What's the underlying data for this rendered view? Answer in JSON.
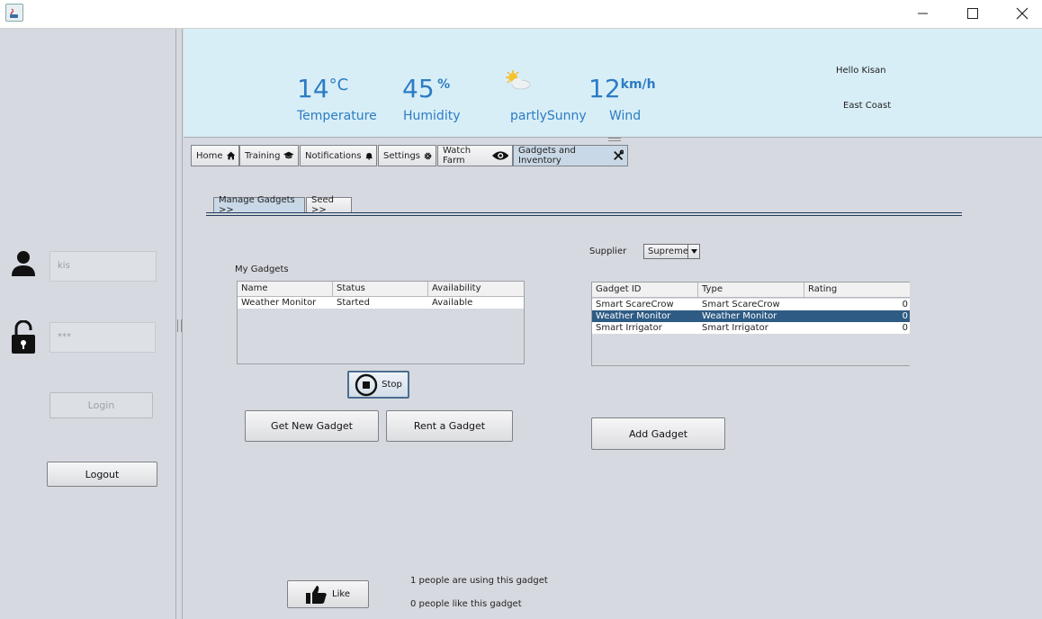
{
  "window": {
    "minimize_icon": "minimize-icon",
    "maximize_icon": "maximize-icon",
    "close_icon": "close-icon"
  },
  "login": {
    "username_value": "kis",
    "password_value": "***",
    "login_label": "Login",
    "logout_label": "Logout"
  },
  "weather": {
    "temperature": {
      "value": "14",
      "unit": "°C",
      "label": "Temperature"
    },
    "humidity": {
      "value": "45",
      "unit": "%",
      "label": "Humidity"
    },
    "condition": {
      "label": "partlySunny",
      "icon": "partly-sunny-icon"
    },
    "wind": {
      "value": "12",
      "unit": "km/h",
      "label": "Wind"
    },
    "greeting": "Hello Kisan",
    "region": "East Coast"
  },
  "tabs": [
    {
      "label": "Home",
      "icon": "home-icon"
    },
    {
      "label": "Training",
      "icon": "graduation-cap-icon"
    },
    {
      "label": "Notifications",
      "icon": "bell-icon"
    },
    {
      "label": "Settings",
      "icon": "gear-icon"
    },
    {
      "label": "Watch Farm",
      "icon": "eye-icon"
    },
    {
      "label": "Gadgets and Inventory",
      "icon": "tools-icon"
    }
  ],
  "subtabs": [
    {
      "label": "Manage Gadgets >>"
    },
    {
      "label": "Seed >>"
    }
  ],
  "my_gadgets": {
    "title": "My Gadgets",
    "columns": [
      "Name",
      "Status",
      "Availability"
    ],
    "rows": [
      [
        "Weather Monitor",
        "Started",
        "Available"
      ]
    ],
    "stop_label": "Stop",
    "get_new_label": "Get New Gadget",
    "rent_label": "Rent a Gadget"
  },
  "supplier": {
    "label": "Supplier",
    "selected": "Supreme",
    "columns": [
      "Gadget ID",
      "Type",
      "Rating"
    ],
    "rows": [
      [
        "Smart ScareCrow",
        "Smart ScareCrow",
        "0"
      ],
      [
        "Weather Monitor",
        "Weather Monitor",
        "0"
      ],
      [
        "Smart Irrigator",
        "Smart Irrigator",
        "0"
      ]
    ],
    "selected_row": 1,
    "add_label": "Add Gadget"
  },
  "footer": {
    "like_label": "Like",
    "users_text": "1 people are using this gadget",
    "likes_text": "0 people like this gadget"
  },
  "colors": {
    "accent": "#2c7cc4",
    "selection": "#2e5b84",
    "weather_bg": "#d8eef6"
  }
}
